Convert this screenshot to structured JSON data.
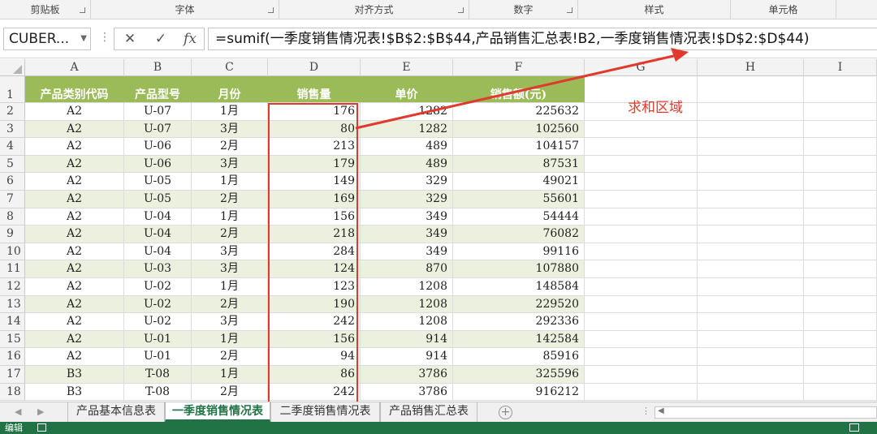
{
  "ribbon": {
    "groups": [
      "剪贴板",
      "字体",
      "对齐方式",
      "数字",
      "样式",
      "单元格"
    ]
  },
  "formula_bar": {
    "name_box": "CUBER...",
    "cancel_symbol": "✕",
    "enter_symbol": "✓",
    "fx_label": "fx",
    "formula": "=sumif(一季度销售情况表!$B$2:$B$44,产品销售汇总表!B2,一季度销售情况表!$D$2:$D$44)"
  },
  "columns": [
    "A",
    "B",
    "C",
    "D",
    "E",
    "F",
    "G",
    "H",
    "I"
  ],
  "table": {
    "headers": [
      "产品类别代码",
      "产品型号",
      "月份",
      "销售量",
      "单价",
      "销售额(元)"
    ],
    "rows": [
      [
        "A2",
        "U-07",
        "1月",
        "176",
        "1282",
        "225632"
      ],
      [
        "A2",
        "U-07",
        "3月",
        "80",
        "1282",
        "102560"
      ],
      [
        "A2",
        "U-06",
        "2月",
        "213",
        "489",
        "104157"
      ],
      [
        "A2",
        "U-06",
        "3月",
        "179",
        "489",
        "87531"
      ],
      [
        "A2",
        "U-05",
        "1月",
        "149",
        "329",
        "49021"
      ],
      [
        "A2",
        "U-05",
        "2月",
        "169",
        "329",
        "55601"
      ],
      [
        "A2",
        "U-04",
        "1月",
        "156",
        "349",
        "54444"
      ],
      [
        "A2",
        "U-04",
        "2月",
        "218",
        "349",
        "76082"
      ],
      [
        "A2",
        "U-04",
        "3月",
        "284",
        "349",
        "99116"
      ],
      [
        "A2",
        "U-03",
        "3月",
        "124",
        "870",
        "107880"
      ],
      [
        "A2",
        "U-02",
        "1月",
        "123",
        "1208",
        "148584"
      ],
      [
        "A2",
        "U-02",
        "2月",
        "190",
        "1208",
        "229520"
      ],
      [
        "A2",
        "U-02",
        "3月",
        "242",
        "1208",
        "292336"
      ],
      [
        "A2",
        "U-01",
        "1月",
        "156",
        "914",
        "142584"
      ],
      [
        "A2",
        "U-01",
        "2月",
        "94",
        "914",
        "85916"
      ],
      [
        "B3",
        "T-08",
        "1月",
        "86",
        "3786",
        "325596"
      ],
      [
        "B3",
        "T-08",
        "2月",
        "242",
        "3786",
        "916212"
      ]
    ]
  },
  "annotation": "求和区域",
  "sheet_tabs": {
    "tabs": [
      "产品基本信息表",
      "一季度销售情况表",
      "二季度销售情况表",
      "产品销售汇总表"
    ],
    "active_tab": "一季度销售情况表"
  },
  "status_bar": {
    "mode": "编辑"
  },
  "colors": {
    "header_fill": "#9bbb59",
    "band_fill": "#ebf1de",
    "annotation_red": "#e03a2f",
    "excel_green": "#217346"
  }
}
